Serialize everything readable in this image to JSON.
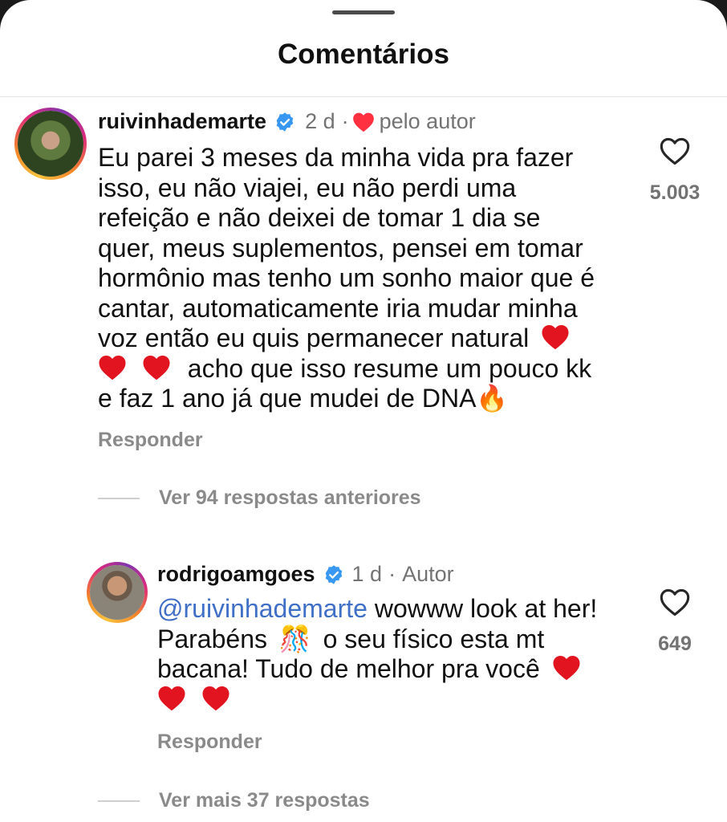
{
  "header": {
    "title": "Comentários"
  },
  "comment": {
    "username": "ruivinhademarte",
    "time": "2 d",
    "separator": "·",
    "liked_by_author": "pelo autor",
    "lines": [
      "Eu parei 3 meses da minha vida pra fazer",
      "isso, eu não viajei, eu não perdi uma",
      "refeição e não deixei de tomar 1 dia se",
      "quer, meus suplementos, pensei em tomar",
      "hormônio mas tenho um sonho maior que é",
      "cantar, automaticamente iria mudar minha",
      "voz então eu quis permanecer natural",
      "acho que isso resume um pouco kk",
      "e faz 1 ano já que mudei de DNA"
    ],
    "fire_emoji": "🔥",
    "reply_label": "Responder",
    "like_count": "5.003",
    "like_icon": "heart-outline-icon"
  },
  "previous_replies": {
    "label": "Ver 94 respostas anteriores"
  },
  "reply": {
    "username": "rodrigoamgoes",
    "time": "1 d",
    "separator": "·",
    "author_label": "Autor",
    "mention": "@ruivinhademarte",
    "line1_rest": " wowww look at her!",
    "line2_start": "Parabéns",
    "confetti_emoji": "🎊",
    "line2_end": "o seu físico esta mt",
    "line3": "bacana! Tudo de melhor pra você",
    "reply_label": "Responder",
    "like_count": "649",
    "like_icon": "heart-outline-icon"
  },
  "more_replies": {
    "label": "Ver mais 37 respostas"
  },
  "colors": {
    "verified": "#3897f0",
    "heart_red": "#ff3040",
    "emoji_heart": "#e1141f",
    "muted": "#737373",
    "mention": "#3f6fc6"
  }
}
